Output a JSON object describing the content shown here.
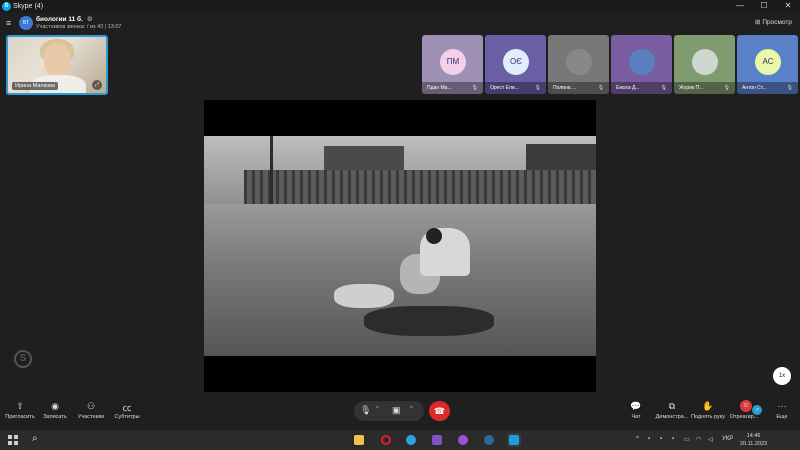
{
  "window": {
    "app_name": "Skype",
    "badge": "(4)",
    "controls": [
      "—",
      "☐",
      "✕"
    ]
  },
  "call": {
    "group_avatar_initials": "БТ",
    "title": "биологии 11 б.",
    "subtitle": "Участников звонка: / из 43 | 13:07",
    "view_button": "Просмотр"
  },
  "self_view": {
    "name": "Ирина Малкова"
  },
  "participants": [
    {
      "name": "Пдан Ма...",
      "initials": "ПМ",
      "bg": "#9e8fb4",
      "avatar_bg": "#f3d0e8",
      "type": "initials"
    },
    {
      "name": "Орест Ели...",
      "initials": "ОЄ",
      "bg": "#6b5fa5",
      "avatar_bg": "#e2edfb",
      "type": "initials"
    },
    {
      "name": "Полина ...",
      "initials": "",
      "bg": "#777",
      "avatar_bg": "#888",
      "type": "photo"
    },
    {
      "name": "Ежоха Д...",
      "initials": "",
      "bg": "#7a5d9e",
      "avatar_bg": "#5b7fbf",
      "type": "photo"
    },
    {
      "name": "Жорик П...",
      "initials": "",
      "bg": "#7f9b6f",
      "avatar_bg": "#cfd8d0",
      "type": "photo"
    },
    {
      "name": "Антон Ст...",
      "initials": "АС",
      "bg": "#5a80c8",
      "avatar_bg": "#e9f7a8",
      "type": "initials"
    }
  ],
  "stage": {
    "speed_label": "1x"
  },
  "toolbar": {
    "left": [
      {
        "label": "Пригласить",
        "icon": "share-icon"
      },
      {
        "label": "Записать",
        "icon": "record-icon"
      },
      {
        "label": "Участники",
        "icon": "participants-icon"
      },
      {
        "label": "Субтитры",
        "icon": "captions-icon"
      }
    ],
    "right": [
      {
        "label": "Чат",
        "icon": "chat-icon"
      },
      {
        "label": "Демонстра...",
        "icon": "screen-share-icon"
      },
      {
        "label": "Поднять руку",
        "icon": "raise-hand-icon"
      },
      {
        "label": "Отреагир...",
        "icon": "react-icon"
      },
      {
        "label": "Еще",
        "icon": "more-icon"
      }
    ]
  },
  "taskbar": {
    "lang": "УКР",
    "time": "14:46",
    "date": "20.11.2023"
  }
}
